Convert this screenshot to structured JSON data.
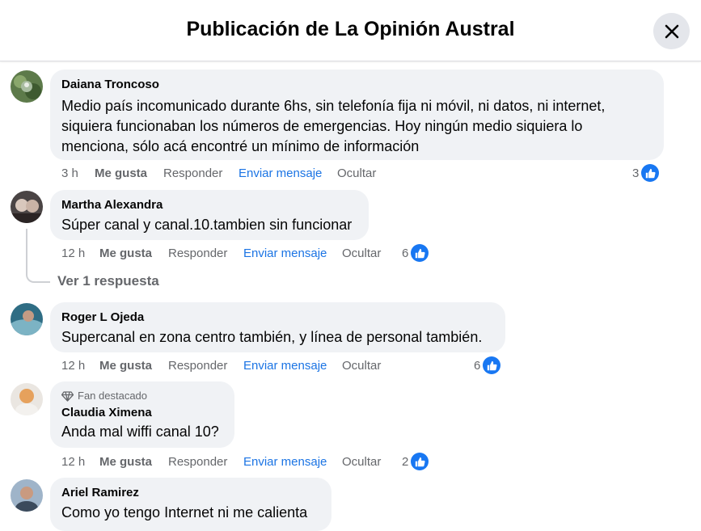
{
  "header": {
    "title": "Publicación de La Opinión Austral"
  },
  "colors": {
    "accent": "#1877f2",
    "link_blue": "#1b74e4",
    "bubble_bg": "#f0f2f5",
    "secondary_text": "#65676b"
  },
  "actions": {
    "like_label": "Me gusta",
    "reply_label": "Responder",
    "message_label": "Enviar mensaje",
    "hide_label": "Ocultar"
  },
  "comments": [
    {
      "author": "Daiana Troncoso",
      "text": "Medio país incomunicado durante 6hs, sin telefonía fija ni móvil, ni datos, ni internet, siquiera funcionaban los números de emergencias. Hoy ningún medio siquiera lo menciona, sólo acá encontré un mínimo de información",
      "time": "3 h",
      "reactions": "3"
    },
    {
      "author": "Martha Alexandra",
      "text": "Súper canal y canal.10.tambien sin funcionar",
      "time": "12 h",
      "reactions": "6",
      "replies_link": "Ver 1 respuesta"
    },
    {
      "author": "Roger L Ojeda",
      "text": "Supercanal en zona centro también, y línea de personal también.",
      "time": "12 h",
      "reactions": "6"
    },
    {
      "badge": "Fan destacado",
      "author": "Claudia Ximena",
      "text": "Anda mal wiffi canal 10?",
      "time": "12 h",
      "reactions": "2"
    },
    {
      "author": "Ariel Ramirez",
      "text": "Como yo tengo Internet ni me calienta"
    }
  ]
}
